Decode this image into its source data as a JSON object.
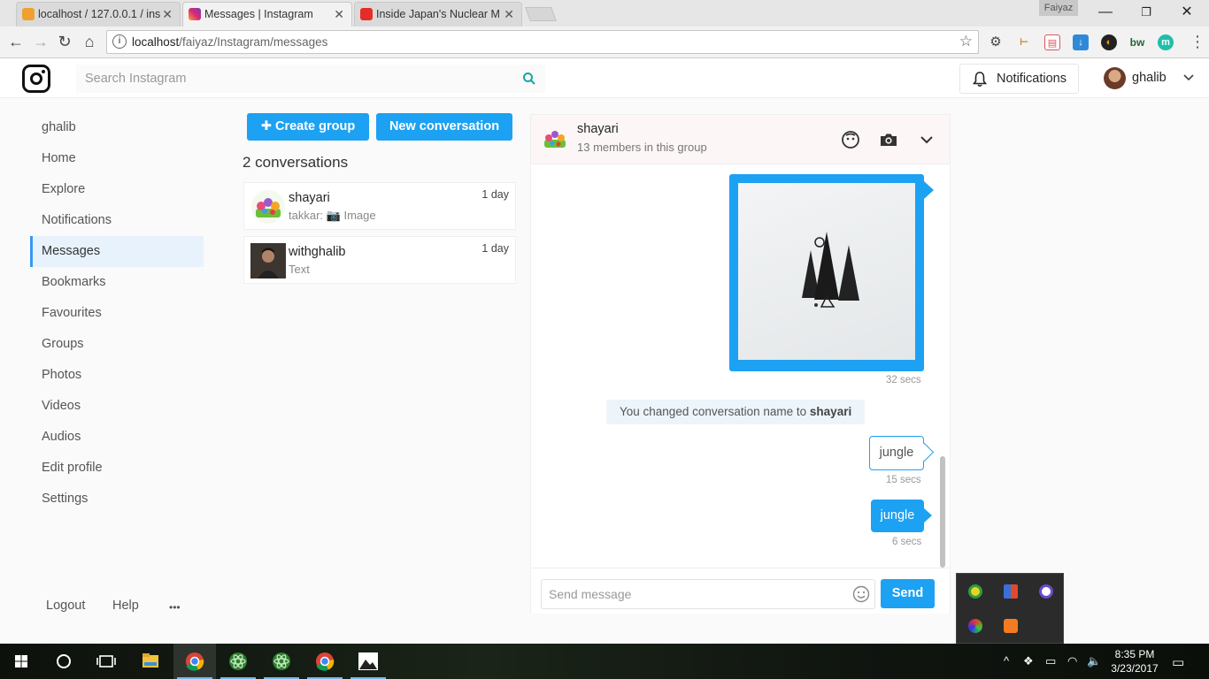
{
  "browser": {
    "tabs": [
      {
        "title": "localhost / 127.0.0.1 / ins",
        "favicon": "phpmyadmin-icon"
      },
      {
        "title": "Messages | Instagram",
        "favicon": "instagram-icon"
      },
      {
        "title": "Inside Japan's Nuclear M",
        "favicon": "youtube-icon"
      }
    ],
    "profile_name": "Faiyaz",
    "url_host": "localhost",
    "url_path": "/faiyaz/Instagram/messages"
  },
  "header": {
    "search_placeholder": "Search Instagram",
    "notifications_label": "Notifications",
    "username": "ghalib"
  },
  "sidebar": {
    "items": [
      {
        "label": "ghalib"
      },
      {
        "label": "Home"
      },
      {
        "label": "Explore"
      },
      {
        "label": "Notifications"
      },
      {
        "label": "Messages"
      },
      {
        "label": "Bookmarks"
      },
      {
        "label": "Favourites"
      },
      {
        "label": "Groups"
      },
      {
        "label": "Photos"
      },
      {
        "label": "Videos"
      },
      {
        "label": "Audios"
      },
      {
        "label": "Edit profile"
      },
      {
        "label": "Settings"
      }
    ],
    "active": "Messages",
    "footer": {
      "logout": "Logout",
      "help": "Help",
      "more": "•••"
    }
  },
  "conversations": {
    "create_group_label": "Create group",
    "new_conversation_label": "New conversation",
    "count_label": "2 conversations",
    "items": [
      {
        "name": "shayari",
        "preview_sender": "takkar:",
        "preview_text": "Image",
        "time": "1 day"
      },
      {
        "name": "withghalib",
        "preview_text": "Text",
        "time": "1 day"
      }
    ]
  },
  "chat": {
    "group_name": "shayari",
    "members_label": "13 members in this group",
    "messages": [
      {
        "type": "image",
        "time": "32 secs"
      },
      {
        "type": "system",
        "text": "You changed conversation name to",
        "highlight": "shayari"
      },
      {
        "type": "text",
        "text": "jungle",
        "time": "15 secs",
        "style": "outline"
      },
      {
        "type": "text",
        "text": "jungle",
        "time": "6 secs",
        "style": "filled"
      }
    ],
    "composer_placeholder": "Send message",
    "send_label": "Send"
  },
  "taskbar": {
    "time": "8:35 PM",
    "date": "3/23/2017"
  },
  "colors": {
    "accent": "#1da1f2",
    "active_nav_bg": "#e8f2fc"
  }
}
